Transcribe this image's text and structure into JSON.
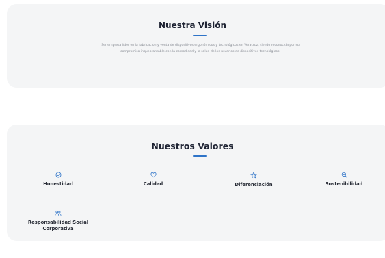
{
  "vision": {
    "title": "Nuestra Visión",
    "text": "Ser empresa líder en la fabricacion y venta de dispositivos ergonómicos y tecnológicos en Veracruz, siendo reconocida por su compromiso inquebrantable con la comodidad y la salud de los usuarios de dispositivos tecnológicos."
  },
  "values": {
    "title": "Nuestros Valores",
    "items": [
      {
        "label": "Honestidad",
        "icon": "check-circle-icon"
      },
      {
        "label": "Calidad",
        "icon": "heart-icon"
      },
      {
        "label": "Diferenciación",
        "icon": "star-icon"
      },
      {
        "label": "Sostenibilidad",
        "icon": "search-leaf-icon"
      },
      {
        "label": "Responsabilidad Social Corporativa",
        "icon": "people-icon"
      }
    ]
  },
  "colors": {
    "accent": "#2f74c8",
    "card_background": "#f4f5f6",
    "title": "#1e2333",
    "body_text": "#8a8e96"
  }
}
